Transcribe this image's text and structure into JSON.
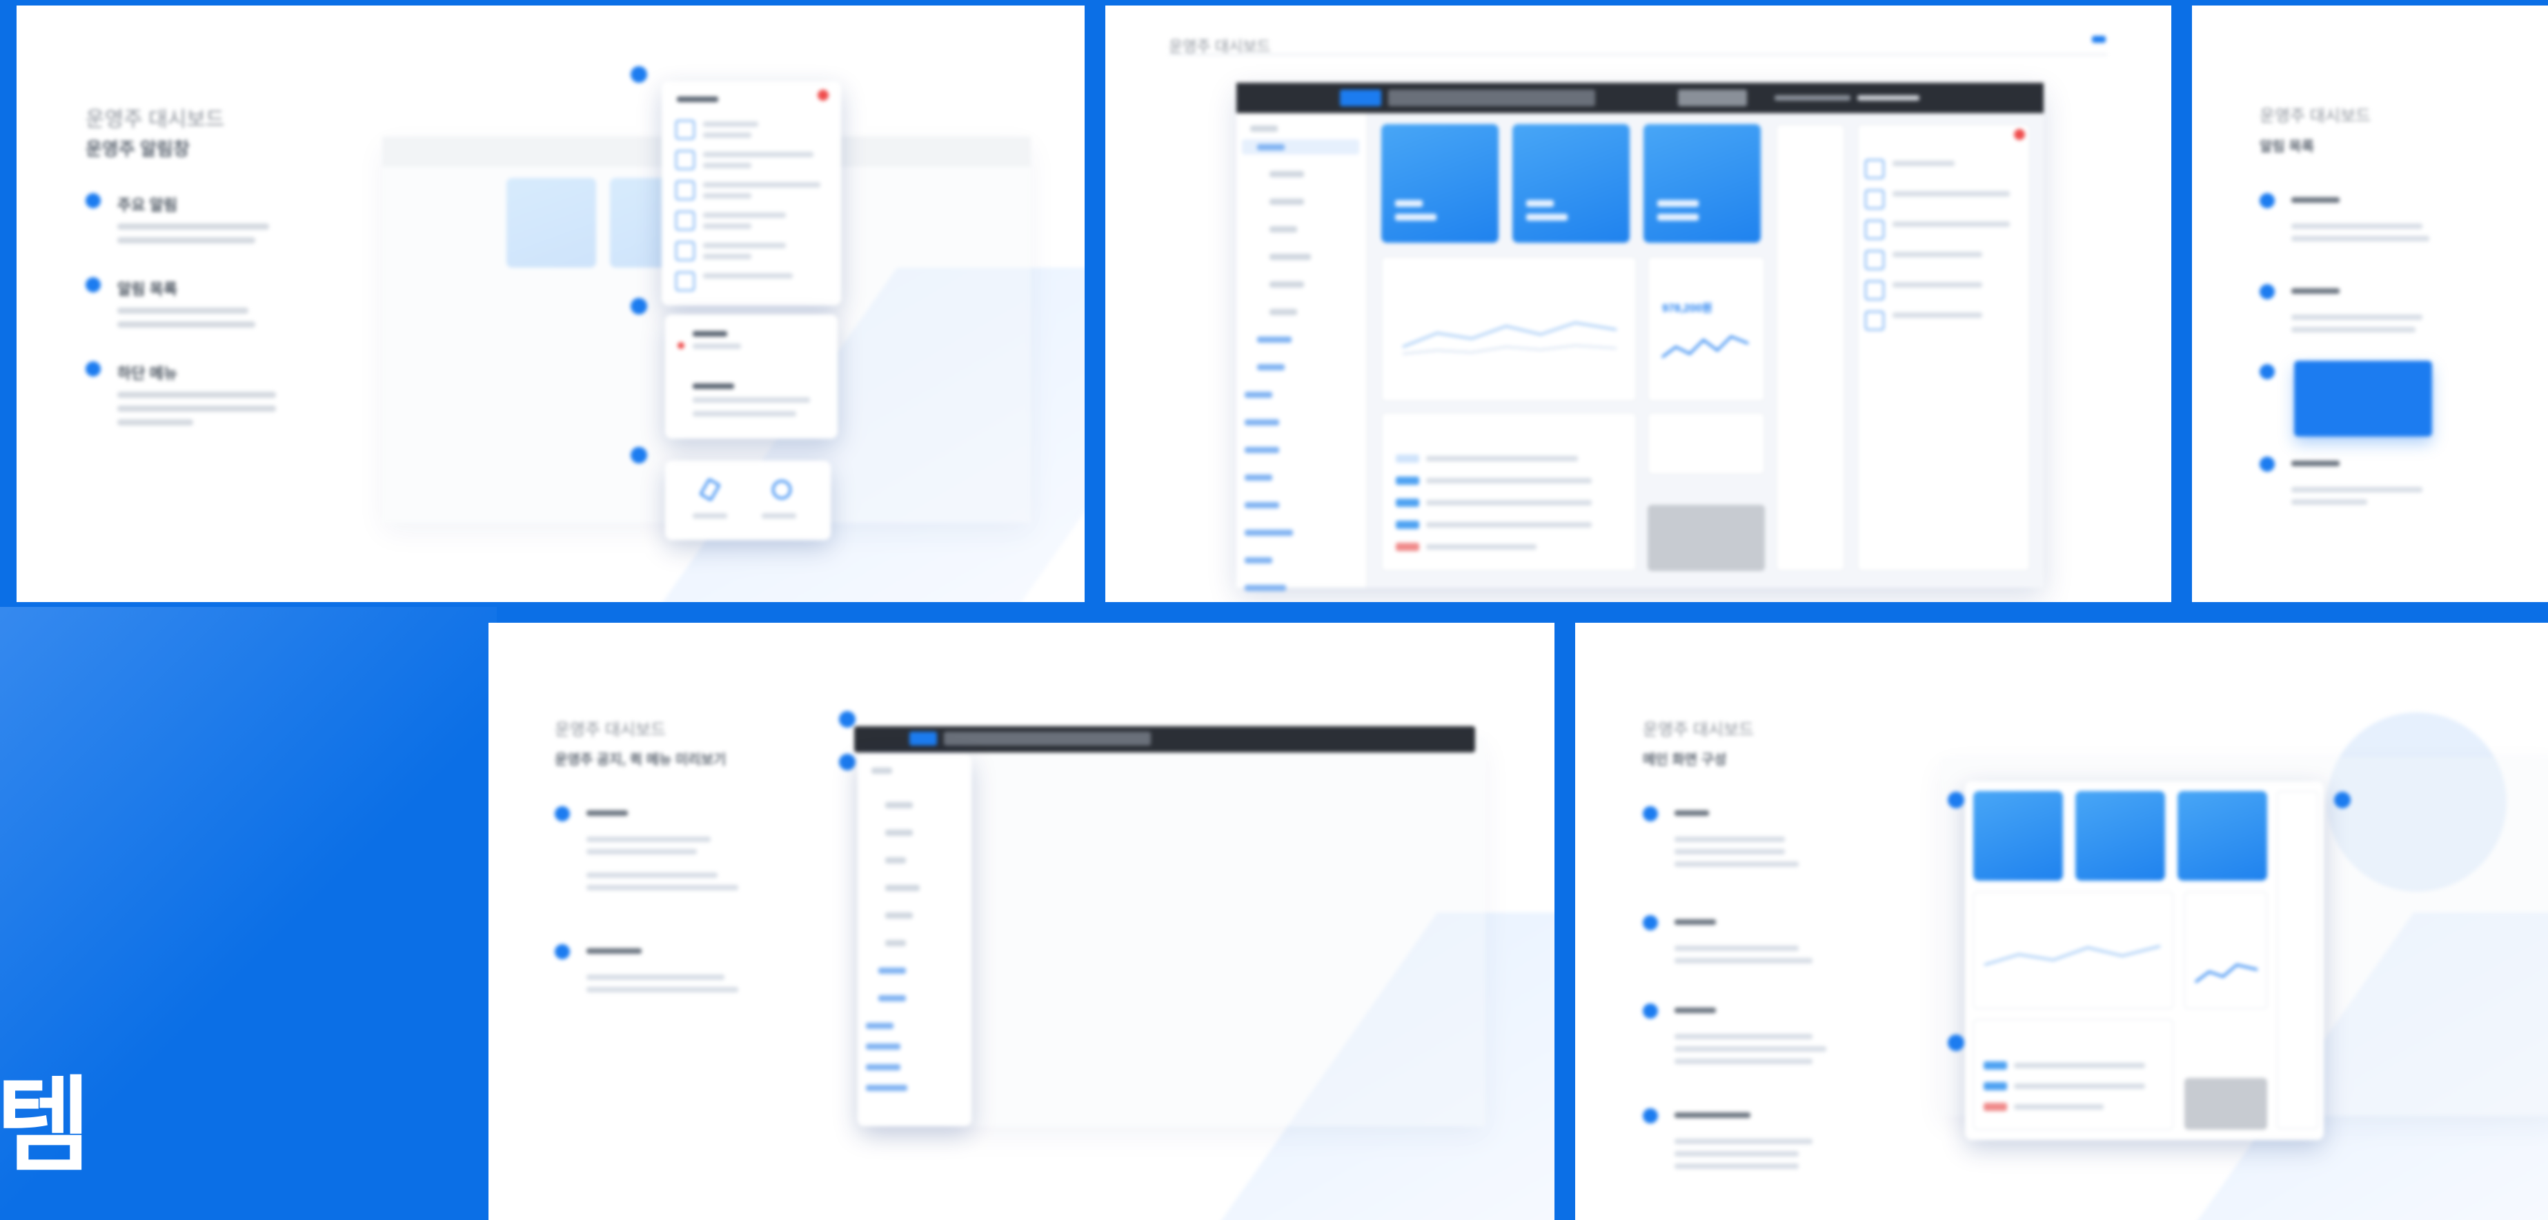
{
  "decor": {
    "big_glyph": "템"
  },
  "panels": {
    "p1": {
      "title": "운영주 대시보드",
      "subtitle": "운영주 알림창",
      "bullets": [
        "주요 알림",
        "알림 목록",
        "하단 메뉴"
      ]
    },
    "p2": {
      "title": "운영주 대시보드"
    },
    "p3": {
      "title": "운영주 대시보드",
      "subtitle": "알림 목록"
    },
    "p4": {
      "title": "운영주 대시보드",
      "subtitle": "운영주 공지, 퀵 메뉴 미리보기"
    },
    "p5": {
      "title": "운영주 대시보드",
      "subtitle": "메인 화면 구성"
    }
  },
  "mock": {
    "big_number": "978,200원"
  },
  "colors": {
    "accent": "#1c7cf0",
    "page_bg": "#0b6fe6",
    "alert": "#ef4d4d"
  }
}
